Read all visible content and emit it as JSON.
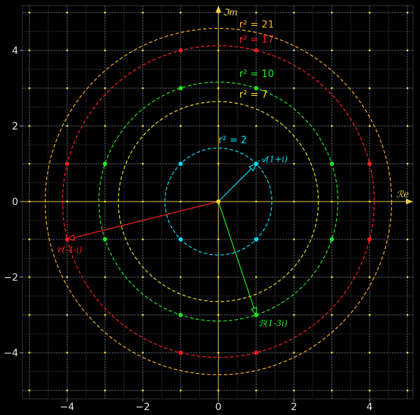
{
  "chart_data": {
    "type": "scatter",
    "title": "",
    "xlim": [
      -5,
      5
    ],
    "ylim": [
      -5,
      5
    ],
    "xticks": [
      -4,
      -2,
      0,
      2,
      4
    ],
    "yticks": [
      -4,
      -2,
      0,
      2,
      4
    ],
    "xtick_labels": [
      "−4",
      "−2",
      "0",
      "2",
      "4"
    ],
    "ytick_labels": [
      "−4",
      "−2",
      "0",
      "2",
      "4"
    ],
    "xlabel": "ℛe",
    "ylabel": "ℑm",
    "grid": true,
    "background_color": "#000000",
    "axis_color": "#f0d040",
    "circles": [
      {
        "r2": 2,
        "label": "r² = 2",
        "color": "#00e5ff",
        "label_at": [
          0.0,
          1.55
        ],
        "points": [
          [
            1,
            1
          ],
          [
            -1,
            1
          ],
          [
            1,
            -1
          ],
          [
            -1,
            -1
          ]
        ]
      },
      {
        "r2": 7,
        "label": "r² = 7",
        "color": "#f0e020",
        "label_at": [
          0.55,
          2.75
        ],
        "points": []
      },
      {
        "r2": 10,
        "label": "r² = 10",
        "color": "#22ee22",
        "label_at": [
          0.55,
          3.3
        ],
        "points": [
          [
            1,
            3
          ],
          [
            -1,
            3
          ],
          [
            3,
            1
          ],
          [
            -3,
            1
          ],
          [
            3,
            -1
          ],
          [
            -3,
            -1
          ],
          [
            1,
            -3
          ],
          [
            -1,
            -3
          ]
        ]
      },
      {
        "r2": 17,
        "label": "r² = 17",
        "color": "#ff2020",
        "label_at": [
          0.55,
          4.2
        ],
        "points": [
          [
            1,
            4
          ],
          [
            -1,
            4
          ],
          [
            4,
            1
          ],
          [
            -4,
            1
          ],
          [
            4,
            -1
          ],
          [
            -4,
            -1
          ],
          [
            1,
            -4
          ],
          [
            -1,
            -4
          ]
        ]
      },
      {
        "r2": 21,
        "label": "r² = 21",
        "color": "#ffb020",
        "label_at": [
          0.55,
          4.6
        ],
        "points": []
      }
    ],
    "lattice_points_color": "#f0e020",
    "origin_point": [
      0,
      0
    ],
    "vectors": [
      {
        "name": "A",
        "label": "𝒜(1+i)",
        "to": [
          1,
          1
        ],
        "color": "#00e5ff",
        "label_at": [
          1.05,
          1.05
        ]
      },
      {
        "name": "B",
        "label": "ℬ(1-3i)",
        "to": [
          1,
          -3
        ],
        "color": "#22ee22",
        "label_at": [
          1.05,
          -3.3
        ]
      },
      {
        "name": "C",
        "label": "𝒞(-4-i)",
        "to": [
          -4,
          -1
        ],
        "color": "#ff2020",
        "label_at": [
          -4.3,
          -1.35
        ]
      }
    ]
  }
}
